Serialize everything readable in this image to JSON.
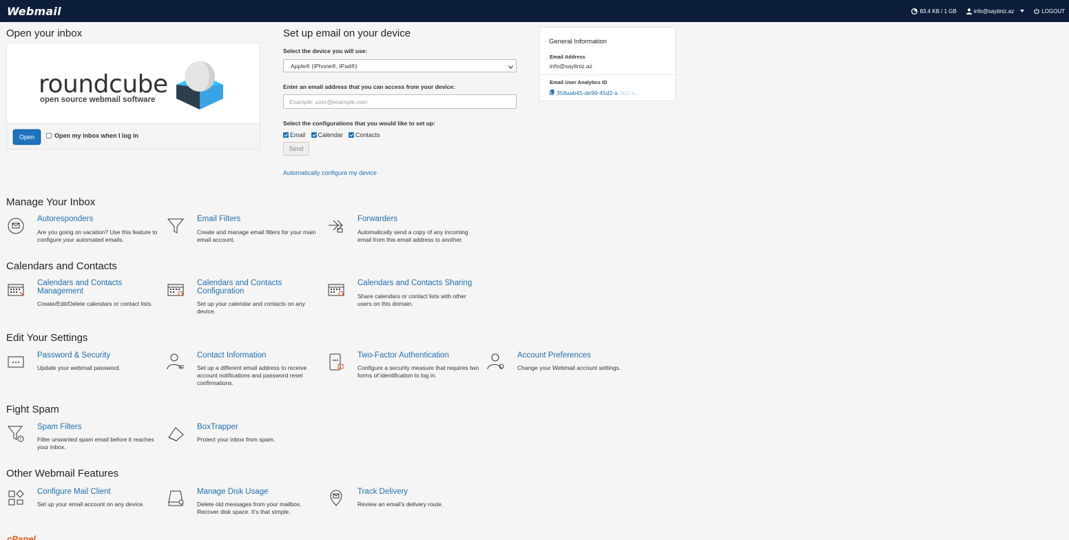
{
  "topbar": {
    "logo": "Webmail",
    "disk": "83.4 KB / 1 GB",
    "user": "info@saytiniz.az",
    "logout": "LOGOUT"
  },
  "inbox": {
    "heading": "Open your inbox",
    "logo_word": "roundcube",
    "logo_sub": "open source webmail software",
    "open_label": "Open",
    "checkbox_label": "Open my inbox when I log in"
  },
  "setup": {
    "heading": "Set up email on your device",
    "device_label": "Select the device you will use:",
    "device_value": "Apple® (iPhone®, iPad®)",
    "email_label": "Enter an email address that you can access from your device:",
    "email_placeholder": "Example: user@example.com",
    "config_label": "Select the configurations that you would like to set up:",
    "checks": [
      "Email",
      "Calendar",
      "Contacts"
    ],
    "send_label": "Send",
    "auto_link": "Automatically configure my device"
  },
  "general": {
    "title": "General Information",
    "email_key": "Email Address",
    "email_val": "info@saytiniz.az",
    "analytics_key": "Email User Analytics ID",
    "analytics_val": "358aab45-de99-45d2-a",
    "analytics_fade": "0b2-e..."
  },
  "sections": {
    "manage": "Manage Your Inbox",
    "calendars": "Calendars and Contacts",
    "settings": "Edit Your Settings",
    "spam": "Fight Spam",
    "other": "Other Webmail Features"
  },
  "features": {
    "autoresponders": {
      "title": "Autoresponders",
      "desc": "Are you going on vacation? Use this feature to configure your automated emails."
    },
    "email_filters": {
      "title": "Email Filters",
      "desc": "Create and manage email filters for your main email account."
    },
    "forwarders": {
      "title": "Forwarders",
      "desc": "Automatically send a copy of any incoming email from this email address to another."
    },
    "cal_mgmt": {
      "title": "Calendars and Contacts Management",
      "desc": "Create/Edit/Delete calendars or contact lists."
    },
    "cal_config": {
      "title": "Calendars and Contacts Configuration",
      "desc": "Set up your calendar and contacts on any device."
    },
    "cal_sharing": {
      "title": "Calendars and Contacts Sharing",
      "desc": "Share calendars or contact lists with other users on this domain."
    },
    "password": {
      "title": "Password & Security",
      "desc": "Update your webmail password."
    },
    "contact_info": {
      "title": "Contact Information",
      "desc": "Set up a different email address to receive account notifications and password reset confirmations."
    },
    "two_factor": {
      "title": "Two-Factor Authentication",
      "desc": "Configure a security measure that requires two forms of identification to log in."
    },
    "account_prefs": {
      "title": "Account Preferences",
      "desc": "Change your Webmail account settings."
    },
    "spam_filters": {
      "title": "Spam Filters",
      "desc": "Filter unwanted spam email before it reaches your inbox."
    },
    "boxtrapper": {
      "title": "BoxTrapper",
      "desc": "Protect your inbox from spam."
    },
    "mail_client": {
      "title": "Configure Mail Client",
      "desc": "Set up your email account on any device."
    },
    "disk_usage": {
      "title": "Manage Disk Usage",
      "desc": "Delete old messages from your mailbox. Recover disk space. It’s that simple."
    },
    "track_delivery": {
      "title": "Track Delivery",
      "desc": "Review an email’s delivery route."
    }
  },
  "footer": {
    "logo": "cPanel"
  },
  "colors": {
    "topbar": "#0d1e3b",
    "link": "#1f6fb2",
    "button": "#1e73be"
  }
}
